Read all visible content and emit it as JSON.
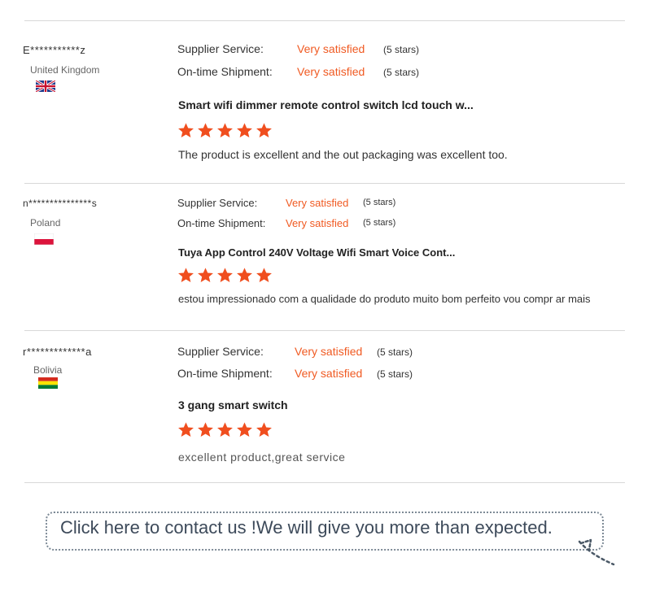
{
  "labels": {
    "supplier_service": "Supplier Service:",
    "ontime_shipment": "On-time Shipment:"
  },
  "reviews": [
    {
      "name": "E***********z",
      "country": "United Kingdom",
      "flag_icon": "uk-flag-icon",
      "supplier_rating": "Very satisfied",
      "supplier_stars": "(5 stars)",
      "shipment_rating": "Very satisfied",
      "shipment_stars": "(5 stars)",
      "product": "Smart wifi dimmer remote control switch lcd touch w...",
      "stars": 5,
      "comment": "The product is excellent and the out packaging was excellent too."
    },
    {
      "name": "n***************s",
      "country": "Poland",
      "flag_icon": "poland-flag-icon",
      "supplier_rating": "Very satisfied",
      "supplier_stars": "(5 stars)",
      "shipment_rating": "Very satisfied",
      "shipment_stars": "(5 stars)",
      "product": "Tuya App Control 240V Voltage Wifi Smart Voice Cont...",
      "stars": 5,
      "comment": "estou impressionado com a qualidade do produto muito bom perfeito vou compr ar mais"
    },
    {
      "name": "r*************a",
      "country": "Bolivia",
      "flag_icon": "bolivia-flag-icon",
      "supplier_rating": "Very satisfied",
      "supplier_stars": "(5 stars)",
      "shipment_rating": "Very satisfied",
      "shipment_stars": "(5 stars)",
      "product": "3 gang smart switch",
      "stars": 5,
      "comment": "excellent product,great service"
    }
  ],
  "contact": {
    "text": "Click here to contact us !We will give you more than expected."
  },
  "colors": {
    "accent": "#f05a22",
    "star": "#f04e1e",
    "divider": "#d8d8d8"
  }
}
